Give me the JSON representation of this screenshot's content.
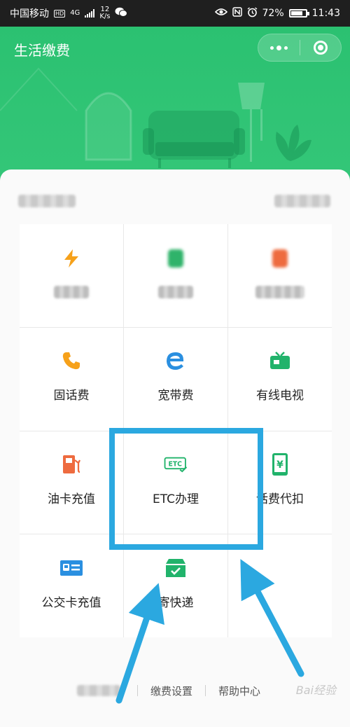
{
  "status_bar": {
    "carrier": "中国移动",
    "hd": "HD",
    "network": "4G",
    "speed_value": "12",
    "speed_unit": "K/s",
    "battery": "72%",
    "time": "11:43"
  },
  "header": {
    "title": "生活缴费"
  },
  "services": [
    {
      "label": "",
      "icon": "lightning-icon",
      "blurred": true
    },
    {
      "label": "",
      "icon": "water-icon",
      "blurred": true
    },
    {
      "label": "",
      "icon": "gas-icon",
      "blurred": true
    },
    {
      "label": "固话费",
      "icon": "phone-icon"
    },
    {
      "label": "宽带费",
      "icon": "broadband-icon"
    },
    {
      "label": "有线电视",
      "icon": "tv-icon"
    },
    {
      "label": "油卡充值",
      "icon": "fuel-icon"
    },
    {
      "label": "ETC办理",
      "icon": "etc-icon"
    },
    {
      "label": "话费代扣",
      "icon": "mobile-yen-icon"
    },
    {
      "label": "公交卡充值",
      "icon": "bus-card-icon"
    },
    {
      "label": "寄快递",
      "icon": "package-icon"
    }
  ],
  "footer": {
    "link_2": "缴费设置",
    "link_3": "帮助中心"
  },
  "watermark": "Bai经验",
  "colors": {
    "brand_green": "#2bc171",
    "annotation_blue": "#2ba8e0",
    "orange": "#f6a11a",
    "red": "#ee6b3f",
    "etc_green": "#21b36b"
  }
}
